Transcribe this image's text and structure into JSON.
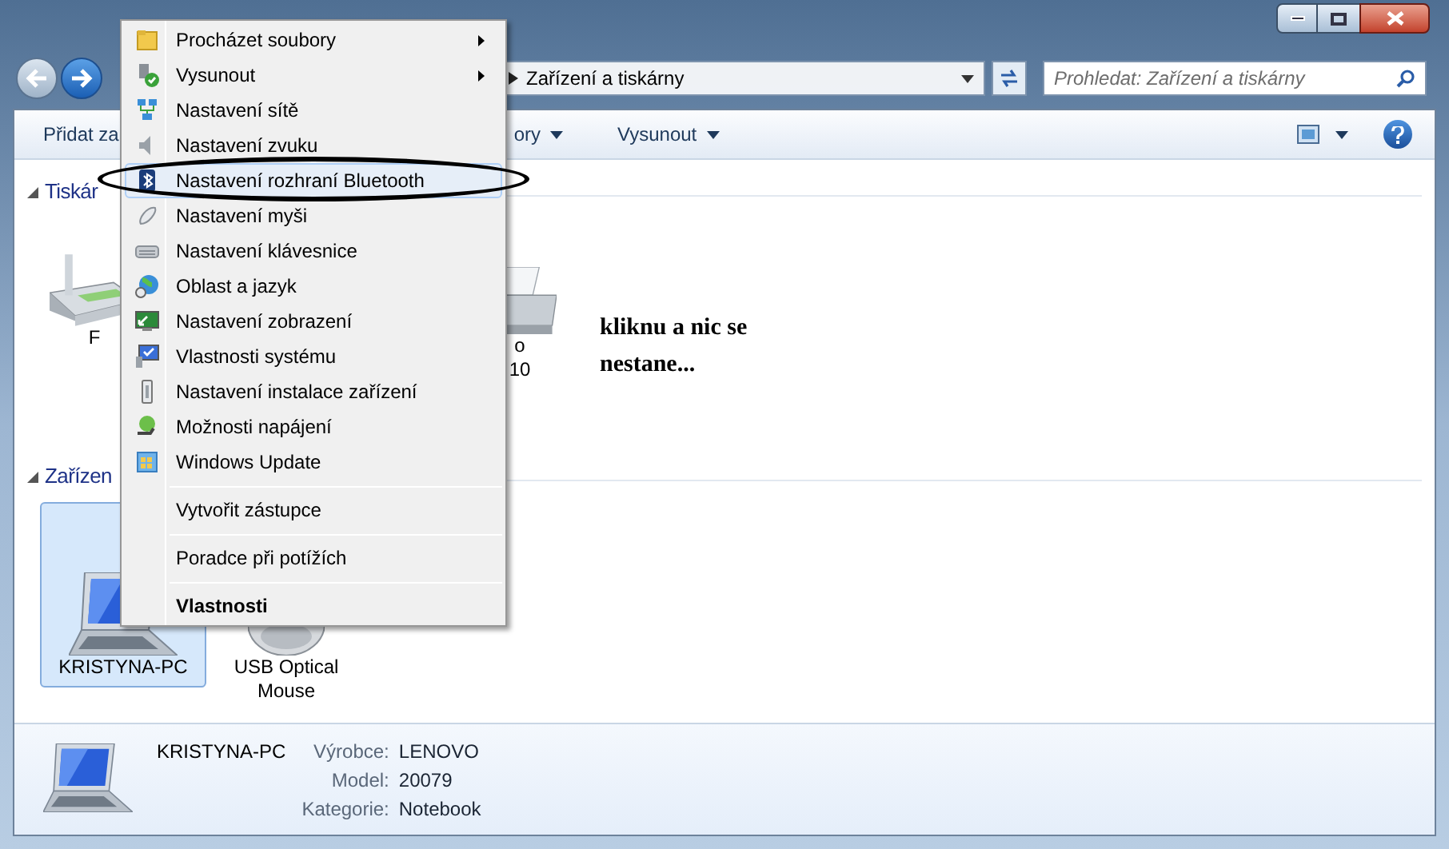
{
  "navigation": {
    "address": "Zařízení a tiskárny",
    "search": {
      "placeholder": "Prohledat: Zařízení a tiskárny"
    }
  },
  "toolbar": [
    {
      "label": "Přidat za",
      "dropdown": false
    },
    {
      "label": "ory",
      "dropdown": true
    },
    {
      "label": "Vysunout",
      "dropdown": true
    }
  ],
  "sections": [
    {
      "title": "Tiskár",
      "expanded": true,
      "items": [
        {
          "kind": "fax",
          "lines": [
            "F"
          ],
          "selected": false
        },
        {
          "kind": "printer",
          "lines": [
            "o",
            "10"
          ],
          "selected": false
        }
      ]
    },
    {
      "title": "Zařízen",
      "expanded": true,
      "items": [
        {
          "kind": "laptop",
          "lines": [
            "KRISTYNA-PC"
          ],
          "selected": true
        },
        {
          "kind": "mouse",
          "lines": [
            "USB Optical",
            "Mouse"
          ],
          "selected": false
        }
      ]
    }
  ],
  "annotation": {
    "text": "kliknu a nic se nestane..."
  },
  "context_menu": [
    {
      "kind": "item",
      "label": "Procházet soubory",
      "submenu": true,
      "bold": false,
      "selected": false,
      "circled": false
    },
    {
      "kind": "item",
      "label": "Vysunout",
      "submenu": true,
      "bold": false,
      "selected": false,
      "circled": false
    },
    {
      "kind": "item",
      "label": "Nastavení sítě",
      "submenu": false,
      "bold": false,
      "selected": false,
      "circled": false
    },
    {
      "kind": "item",
      "label": "Nastavení zvuku",
      "submenu": false,
      "bold": false,
      "selected": false,
      "circled": false
    },
    {
      "kind": "item",
      "label": "Nastavení rozhraní Bluetooth",
      "submenu": false,
      "bold": false,
      "selected": true,
      "circled": true
    },
    {
      "kind": "item",
      "label": "Nastavení myši",
      "submenu": false,
      "bold": false,
      "selected": false,
      "circled": false
    },
    {
      "kind": "item",
      "label": "Nastavení klávesnice",
      "submenu": false,
      "bold": false,
      "selected": false,
      "circled": false
    },
    {
      "kind": "item",
      "label": "Oblast a jazyk",
      "submenu": false,
      "bold": false,
      "selected": false,
      "circled": false
    },
    {
      "kind": "item",
      "label": "Nastavení zobrazení",
      "submenu": false,
      "bold": false,
      "selected": false,
      "circled": false
    },
    {
      "kind": "item",
      "label": "Vlastnosti systému",
      "submenu": false,
      "bold": false,
      "selected": false,
      "circled": false
    },
    {
      "kind": "item",
      "label": "Nastavení instalace zařízení",
      "submenu": false,
      "bold": false,
      "selected": false,
      "circled": false
    },
    {
      "kind": "item",
      "label": "Možnosti napájení",
      "submenu": false,
      "bold": false,
      "selected": false,
      "circled": false
    },
    {
      "kind": "item",
      "label": "Windows Update",
      "submenu": false,
      "bold": false,
      "selected": false,
      "circled": false
    },
    {
      "kind": "separator"
    },
    {
      "kind": "item",
      "label": "Vytvořit zástupce",
      "submenu": false,
      "bold": false,
      "selected": false,
      "circled": false
    },
    {
      "kind": "separator"
    },
    {
      "kind": "item",
      "label": "Poradce při potížích",
      "submenu": false,
      "bold": false,
      "selected": false,
      "circled": false
    },
    {
      "kind": "separator"
    },
    {
      "kind": "item",
      "label": "Vlastnosti",
      "submenu": false,
      "bold": true,
      "selected": false,
      "circled": false
    }
  ],
  "details": {
    "name": "KRISTYNA-PC",
    "properties": [
      {
        "label": "Výrobce:",
        "value": "LENOVO"
      },
      {
        "label": "Model:",
        "value": "20079"
      },
      {
        "label": "Kategorie:",
        "value": "Notebook"
      }
    ]
  }
}
